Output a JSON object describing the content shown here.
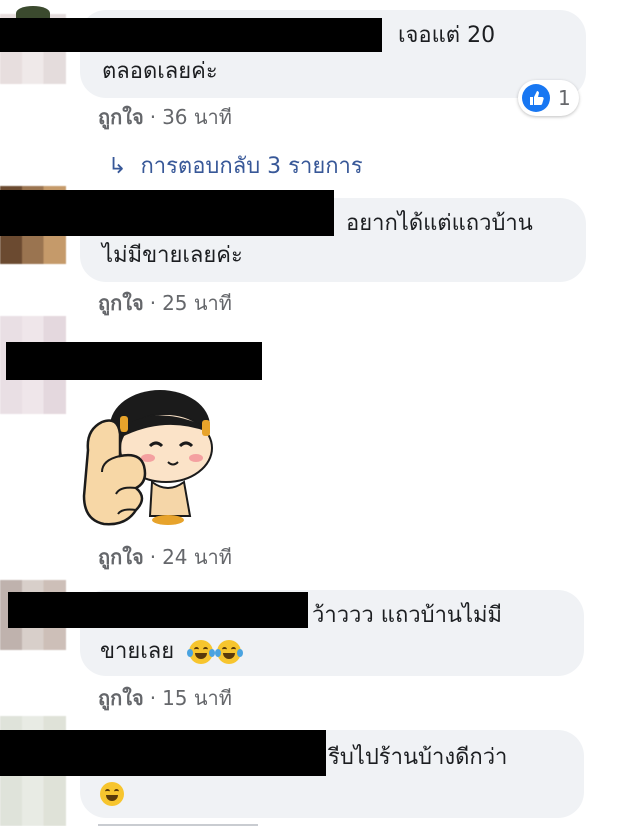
{
  "comments": [
    {
      "text_line1": "เจอแต่ 20",
      "text_line2": "ตลอดเลยค่ะ",
      "like_label": "ถูกใจ",
      "time": "36 นาที",
      "reaction_count": "1",
      "replies_link": "การตอบกลับ 3 รายการ"
    },
    {
      "text_line1": "อยากได้แต่แถวบ้าน",
      "text_line2": "ไม่มีขายเลยค่ะ",
      "like_label": "ถูกใจ",
      "time": "25 นาที"
    },
    {
      "sticker": "thumbs-up-girl-sticker",
      "like_label": "ถูกใจ",
      "time": "24 นาที"
    },
    {
      "text_line1": "ว้าววว แถวบ้านไม่มี",
      "text_line2": "ขายเลย",
      "emojis": [
        "laughing-tears-emoji",
        "laughing-tears-emoji"
      ],
      "like_label": "ถูกใจ",
      "time": "15 นาที"
    },
    {
      "text_line1": "รีบไปร้านบ้างดีกว่า",
      "emojis": [
        "grinning-emoji"
      ]
    }
  ],
  "separator": "·"
}
